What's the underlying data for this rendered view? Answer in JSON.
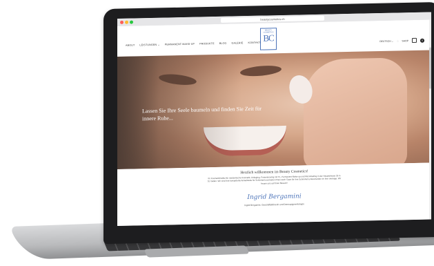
{
  "browser": {
    "url": "beautycosmetics.ch"
  },
  "nav": {
    "items": [
      "About",
      "Leistungen ⌄",
      "Permanent-Make-Up",
      "Produkte",
      "Blog",
      "Galerie",
      "Kontakt"
    ],
    "logo_caption": "BEAUTY COSMETICS",
    "logo_mark": "BC",
    "right": {
      "language": "DEUTSCH ⌄",
      "shop": "SHOP",
      "cart_count": "0"
    }
  },
  "hero": {
    "headline": "Lassen Sie Ihre Seele baumeln und finden Sie Zeit für innere Ruhe..."
  },
  "content": {
    "welcome": "Herzlich willkommen im Beauty Cosmetics!",
    "paragraph": "Ihr Kosmetikinstitut für medizinische Kosmetik, Antiaging, Powerbrowing mit PL, Permanent-Make-up und Microblading in der Hauptstrasse 26 in St. Gallen. Wir sind Ihre kompetente Anlaufstelle für Schönheit und bieten Ihnen auch Tipps für Ihre Schönheit untereinander im Ihre Verträge. Wir freuen uns auf Ihren Besuch!",
    "signature": "Ingrid Bergamini",
    "signature_caption": "Ingrid Bergamini, Geschäftsführerin und Dermapigmentologin"
  },
  "colors": {
    "accent": "#4a72b8",
    "laptop": "#1d1d1f"
  }
}
